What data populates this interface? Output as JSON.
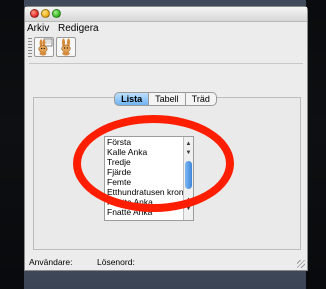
{
  "menu": [
    "Arkiv",
    "Redigera"
  ],
  "tabs": [
    {
      "label": "Lista",
      "active": true
    },
    {
      "label": "Tabell",
      "active": false
    },
    {
      "label": "Träd",
      "active": false
    }
  ],
  "list": {
    "items": [
      "Första",
      "Kalle Anka",
      "Tredje",
      "Fjärde",
      "Femte",
      "Etthundratusen kronor",
      "Knatte Anka",
      "Fnatte Anka"
    ]
  },
  "status": {
    "user_label": "Användare:",
    "password_label": "Lösenord:"
  },
  "colors": {
    "annotation_circle": "#ff1e00",
    "tab_active": "#6fb3f2",
    "scroll_thumb": "#3f86d8"
  },
  "icons": {
    "toolbar_1": "rabbit-notepad-icon",
    "toolbar_2": "rabbit-icon"
  }
}
